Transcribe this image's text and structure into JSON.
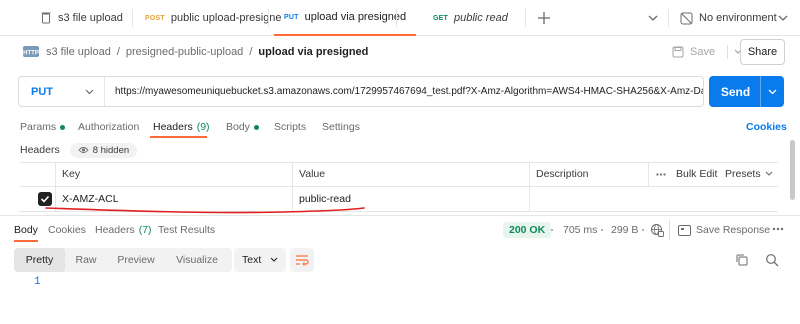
{
  "tabs": [
    {
      "method": "",
      "label": "s3 file upload",
      "icon": "file-stack-icon"
    },
    {
      "method": "POST",
      "label": "public upload-presigne",
      "method_color": "#e8a23b"
    },
    {
      "method": "PUT",
      "label": "upload via presigned",
      "method_color": "#097bed",
      "active": true
    },
    {
      "method": "GET",
      "label": "public read",
      "method_color": "#0d8a5a"
    }
  ],
  "tabbar": {
    "new_tab_icon": "plus-icon",
    "overflow_icon": "chevron-down-icon"
  },
  "environment": {
    "label": "No environment",
    "icon": "no-environment-icon"
  },
  "breadcrumb": {
    "icon": "http-request-icon",
    "items": [
      "s3 file upload",
      "presigned-public-upload"
    ],
    "separator": "/",
    "current": "upload via presigned"
  },
  "toolbar": {
    "save_label": "Save",
    "share_label": "Share"
  },
  "request": {
    "method": "PUT",
    "url": "https://myawesomeuniquebucket.s3.amazonaws.com/1729957467694_test.pdf?X-Amz-Algorithm=AWS4-HMAC-SHA256&X-Amz-Dat...",
    "send_label": "Send"
  },
  "request_tabs": [
    {
      "label": "Params",
      "dot": true
    },
    {
      "label": "Authorization"
    },
    {
      "label": "Headers",
      "count": "(9)",
      "active": true
    },
    {
      "label": "Body",
      "dot": true
    },
    {
      "label": "Scripts"
    },
    {
      "label": "Settings"
    }
  ],
  "cookies_label": "Cookies",
  "headers_section": {
    "label": "Headers",
    "hidden_label": "8 hidden"
  },
  "headers_table": {
    "columns": [
      "Key",
      "Value",
      "Description"
    ],
    "bulk_edit": "Bulk Edit",
    "presets": "Presets",
    "rows": [
      {
        "key": "X-AMZ-ACL",
        "value": "public-read",
        "checked": true
      }
    ]
  },
  "response": {
    "tabs": [
      {
        "label": "Body",
        "active": true
      },
      {
        "label": "Cookies"
      },
      {
        "label": "Headers",
        "count": "(7)"
      },
      {
        "label": "Test Results"
      }
    ],
    "status": "200 OK",
    "time": "705 ms",
    "size": "299 B",
    "save_label": "Save Response",
    "formats": [
      "Pretty",
      "Raw",
      "Preview",
      "Visualize"
    ],
    "active_format": "Pretty",
    "text_select": "Text",
    "line_numbers": [
      "1"
    ]
  },
  "colors": {
    "accent": "#ff6c37",
    "send": "#097bed",
    "annotation": "#e02020"
  }
}
